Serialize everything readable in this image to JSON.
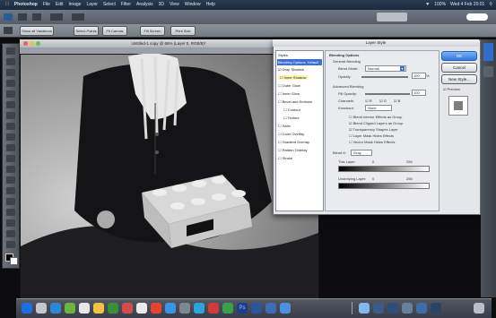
{
  "menubar": {
    "app": "Photoshop",
    "items": [
      "File",
      "Edit",
      "Image",
      "Layer",
      "Select",
      "Filter",
      "Analysis",
      "3D",
      "View",
      "Window",
      "Help"
    ],
    "status": "100%",
    "clock": "Wed 4 Feb 20:01"
  },
  "optionsbar": {
    "buttons": [
      "Show all Variations",
      "Select Points",
      "Fit Canvas",
      "Fill Screen",
      "Print Size"
    ]
  },
  "document": {
    "title": "Untitled-1 copy @ 66% (Layer 0, RGB/8)*"
  },
  "dialog": {
    "title": "Layer Style",
    "styles": [
      {
        "label": "Styles",
        "checked": false
      },
      {
        "label": "Blending Options: Default",
        "checked": false,
        "selected": true
      },
      {
        "label": "Drop Shadow",
        "checked": true
      },
      {
        "label": "Inner Shadow",
        "checked": false
      },
      {
        "label": "Outer Glow",
        "checked": false
      },
      {
        "label": "Inner Glow",
        "checked": false
      },
      {
        "label": "Bevel and Emboss",
        "checked": false
      },
      {
        "label": "Contour",
        "checked": false
      },
      {
        "label": "Texture",
        "checked": false
      },
      {
        "label": "Satin",
        "checked": false
      },
      {
        "label": "Color Overlay",
        "checked": false
      },
      {
        "label": "Gradient Overlay",
        "checked": false
      },
      {
        "label": "Pattern Overlay",
        "checked": false
      },
      {
        "label": "Stroke",
        "checked": false
      }
    ],
    "section_blending": "Blending Options",
    "section_general": "General Blending",
    "blend_mode_label": "Blend Mode:",
    "blend_mode_value": "Normal",
    "opacity_label": "Opacity:",
    "opacity_value": "100",
    "section_advanced": "Advanced Blending",
    "fill_opacity_label": "Fill Opacity:",
    "fill_opacity_value": "100",
    "channels_label": "Channels:",
    "channels": [
      "R",
      "G",
      "B"
    ],
    "knockout_label": "Knockout:",
    "knockout_value": "None",
    "advanced_checks": [
      "Blend Interior Effects as Group",
      "Blend Clipped Layers as Group",
      "Transparency Shapes Layer",
      "Layer Mask Hides Effects",
      "Vector Mask Hides Effects"
    ],
    "blend_if_label": "Blend If:",
    "blend_if_value": "Gray",
    "this_layer_label": "This Layer:",
    "this_layer_values": [
      "0",
      "255"
    ],
    "underlying_label": "Underlying Layer:",
    "underlying_values": [
      "0",
      "255"
    ],
    "ok": "OK",
    "cancel": "Cancel",
    "new_style": "New Style...",
    "preview": "Preview"
  },
  "colors": {
    "menubar": "#1d2a3d",
    "dialog_bg": "#e4e6e9",
    "selection": "#3b6fd6"
  }
}
